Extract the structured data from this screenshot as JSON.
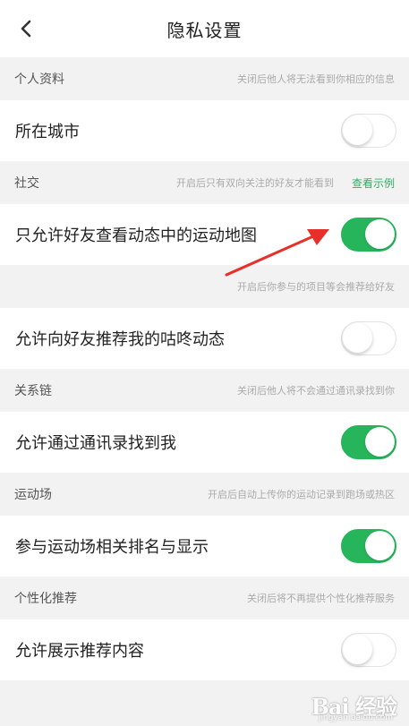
{
  "nav": {
    "title": "隐私设置",
    "back_icon": "chevron-left-icon"
  },
  "sections": {
    "profile": {
      "title": "个人资料",
      "note": "关闭后他人将无法看到你相应的信息",
      "city": {
        "label": "所在城市",
        "enabled": false
      }
    },
    "social": {
      "title": "社交",
      "note": "开启后只有双向关注的好友才能看到",
      "link": "查看示例",
      "friends_only_map": {
        "label": "只允许好友查看动态中的运动地图",
        "enabled": true
      },
      "recommend_note": "开启后你参与的项目等会推荐给好友",
      "recommend_gudong": {
        "label": "允许向好友推荐我的咕咚动态",
        "enabled": false
      }
    },
    "contacts": {
      "title": "关系链",
      "note": "关闭后他人将不会通过通讯录找到你",
      "find_by_contacts": {
        "label": "允许通过通讯录找到我",
        "enabled": true
      }
    },
    "arena": {
      "title": "运动场",
      "note": "开启后自动上传你的运动记录到跑场或热区",
      "ranking_display": {
        "label": "参与运动场相关排名与显示",
        "enabled": true
      }
    },
    "personalized": {
      "title": "个性化推荐",
      "note": "关闭后将不再提供个性化推荐服务",
      "show_recommendations": {
        "label": "允许展示推荐内容",
        "enabled": false
      }
    }
  },
  "colors": {
    "accent_green": "#27b55c",
    "link_green": "#2fae63",
    "annotation_red": "#e8302a",
    "background": "#f2f2f2"
  },
  "watermark": {
    "logo": "Bai 经验",
    "sub": "jingyan.baidu.com"
  }
}
